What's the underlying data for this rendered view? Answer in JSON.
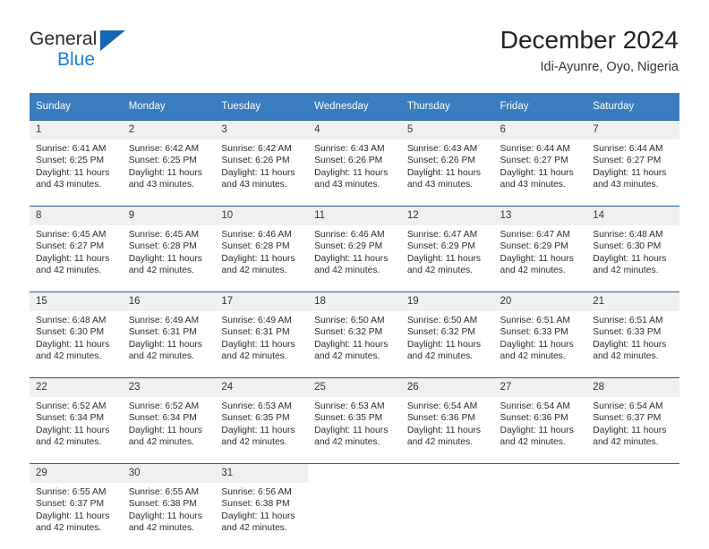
{
  "brand": {
    "name_part1": "General",
    "name_part2": "Blue",
    "triangle_color": "#1667b2",
    "blue_color": "#1a7fd4"
  },
  "header": {
    "title": "December 2024",
    "subtitle": "Idi-Ayunre, Oyo, Nigeria"
  },
  "theme": {
    "header_bg": "#3a7cbe",
    "week_separator": "#1d5f9e",
    "daynum_bg": "#f0f0f0",
    "text": "#222222"
  },
  "calendar": {
    "weekdays": [
      "Sunday",
      "Monday",
      "Tuesday",
      "Wednesday",
      "Thursday",
      "Friday",
      "Saturday"
    ],
    "weeks": [
      [
        {
          "day": "1",
          "sunrise": "Sunrise: 6:41 AM",
          "sunset": "Sunset: 6:25 PM",
          "daylight1": "Daylight: 11 hours",
          "daylight2": "and 43 minutes."
        },
        {
          "day": "2",
          "sunrise": "Sunrise: 6:42 AM",
          "sunset": "Sunset: 6:25 PM",
          "daylight1": "Daylight: 11 hours",
          "daylight2": "and 43 minutes."
        },
        {
          "day": "3",
          "sunrise": "Sunrise: 6:42 AM",
          "sunset": "Sunset: 6:26 PM",
          "daylight1": "Daylight: 11 hours",
          "daylight2": "and 43 minutes."
        },
        {
          "day": "4",
          "sunrise": "Sunrise: 6:43 AM",
          "sunset": "Sunset: 6:26 PM",
          "daylight1": "Daylight: 11 hours",
          "daylight2": "and 43 minutes."
        },
        {
          "day": "5",
          "sunrise": "Sunrise: 6:43 AM",
          "sunset": "Sunset: 6:26 PM",
          "daylight1": "Daylight: 11 hours",
          "daylight2": "and 43 minutes."
        },
        {
          "day": "6",
          "sunrise": "Sunrise: 6:44 AM",
          "sunset": "Sunset: 6:27 PM",
          "daylight1": "Daylight: 11 hours",
          "daylight2": "and 43 minutes."
        },
        {
          "day": "7",
          "sunrise": "Sunrise: 6:44 AM",
          "sunset": "Sunset: 6:27 PM",
          "daylight1": "Daylight: 11 hours",
          "daylight2": "and 43 minutes."
        }
      ],
      [
        {
          "day": "8",
          "sunrise": "Sunrise: 6:45 AM",
          "sunset": "Sunset: 6:27 PM",
          "daylight1": "Daylight: 11 hours",
          "daylight2": "and 42 minutes."
        },
        {
          "day": "9",
          "sunrise": "Sunrise: 6:45 AM",
          "sunset": "Sunset: 6:28 PM",
          "daylight1": "Daylight: 11 hours",
          "daylight2": "and 42 minutes."
        },
        {
          "day": "10",
          "sunrise": "Sunrise: 6:46 AM",
          "sunset": "Sunset: 6:28 PM",
          "daylight1": "Daylight: 11 hours",
          "daylight2": "and 42 minutes."
        },
        {
          "day": "11",
          "sunrise": "Sunrise: 6:46 AM",
          "sunset": "Sunset: 6:29 PM",
          "daylight1": "Daylight: 11 hours",
          "daylight2": "and 42 minutes."
        },
        {
          "day": "12",
          "sunrise": "Sunrise: 6:47 AM",
          "sunset": "Sunset: 6:29 PM",
          "daylight1": "Daylight: 11 hours",
          "daylight2": "and 42 minutes."
        },
        {
          "day": "13",
          "sunrise": "Sunrise: 6:47 AM",
          "sunset": "Sunset: 6:29 PM",
          "daylight1": "Daylight: 11 hours",
          "daylight2": "and 42 minutes."
        },
        {
          "day": "14",
          "sunrise": "Sunrise: 6:48 AM",
          "sunset": "Sunset: 6:30 PM",
          "daylight1": "Daylight: 11 hours",
          "daylight2": "and 42 minutes."
        }
      ],
      [
        {
          "day": "15",
          "sunrise": "Sunrise: 6:48 AM",
          "sunset": "Sunset: 6:30 PM",
          "daylight1": "Daylight: 11 hours",
          "daylight2": "and 42 minutes."
        },
        {
          "day": "16",
          "sunrise": "Sunrise: 6:49 AM",
          "sunset": "Sunset: 6:31 PM",
          "daylight1": "Daylight: 11 hours",
          "daylight2": "and 42 minutes."
        },
        {
          "day": "17",
          "sunrise": "Sunrise: 6:49 AM",
          "sunset": "Sunset: 6:31 PM",
          "daylight1": "Daylight: 11 hours",
          "daylight2": "and 42 minutes."
        },
        {
          "day": "18",
          "sunrise": "Sunrise: 6:50 AM",
          "sunset": "Sunset: 6:32 PM",
          "daylight1": "Daylight: 11 hours",
          "daylight2": "and 42 minutes."
        },
        {
          "day": "19",
          "sunrise": "Sunrise: 6:50 AM",
          "sunset": "Sunset: 6:32 PM",
          "daylight1": "Daylight: 11 hours",
          "daylight2": "and 42 minutes."
        },
        {
          "day": "20",
          "sunrise": "Sunrise: 6:51 AM",
          "sunset": "Sunset: 6:33 PM",
          "daylight1": "Daylight: 11 hours",
          "daylight2": "and 42 minutes."
        },
        {
          "day": "21",
          "sunrise": "Sunrise: 6:51 AM",
          "sunset": "Sunset: 6:33 PM",
          "daylight1": "Daylight: 11 hours",
          "daylight2": "and 42 minutes."
        }
      ],
      [
        {
          "day": "22",
          "sunrise": "Sunrise: 6:52 AM",
          "sunset": "Sunset: 6:34 PM",
          "daylight1": "Daylight: 11 hours",
          "daylight2": "and 42 minutes."
        },
        {
          "day": "23",
          "sunrise": "Sunrise: 6:52 AM",
          "sunset": "Sunset: 6:34 PM",
          "daylight1": "Daylight: 11 hours",
          "daylight2": "and 42 minutes."
        },
        {
          "day": "24",
          "sunrise": "Sunrise: 6:53 AM",
          "sunset": "Sunset: 6:35 PM",
          "daylight1": "Daylight: 11 hours",
          "daylight2": "and 42 minutes."
        },
        {
          "day": "25",
          "sunrise": "Sunrise: 6:53 AM",
          "sunset": "Sunset: 6:35 PM",
          "daylight1": "Daylight: 11 hours",
          "daylight2": "and 42 minutes."
        },
        {
          "day": "26",
          "sunrise": "Sunrise: 6:54 AM",
          "sunset": "Sunset: 6:36 PM",
          "daylight1": "Daylight: 11 hours",
          "daylight2": "and 42 minutes."
        },
        {
          "day": "27",
          "sunrise": "Sunrise: 6:54 AM",
          "sunset": "Sunset: 6:36 PM",
          "daylight1": "Daylight: 11 hours",
          "daylight2": "and 42 minutes."
        },
        {
          "day": "28",
          "sunrise": "Sunrise: 6:54 AM",
          "sunset": "Sunset: 6:37 PM",
          "daylight1": "Daylight: 11 hours",
          "daylight2": "and 42 minutes."
        }
      ],
      [
        {
          "day": "29",
          "sunrise": "Sunrise: 6:55 AM",
          "sunset": "Sunset: 6:37 PM",
          "daylight1": "Daylight: 11 hours",
          "daylight2": "and 42 minutes."
        },
        {
          "day": "30",
          "sunrise": "Sunrise: 6:55 AM",
          "sunset": "Sunset: 6:38 PM",
          "daylight1": "Daylight: 11 hours",
          "daylight2": "and 42 minutes."
        },
        {
          "day": "31",
          "sunrise": "Sunrise: 6:56 AM",
          "sunset": "Sunset: 6:38 PM",
          "daylight1": "Daylight: 11 hours",
          "daylight2": "and 42 minutes."
        },
        {
          "day": "",
          "sunrise": "",
          "sunset": "",
          "daylight1": "",
          "daylight2": ""
        },
        {
          "day": "",
          "sunrise": "",
          "sunset": "",
          "daylight1": "",
          "daylight2": ""
        },
        {
          "day": "",
          "sunrise": "",
          "sunset": "",
          "daylight1": "",
          "daylight2": ""
        },
        {
          "day": "",
          "sunrise": "",
          "sunset": "",
          "daylight1": "",
          "daylight2": ""
        }
      ]
    ]
  }
}
